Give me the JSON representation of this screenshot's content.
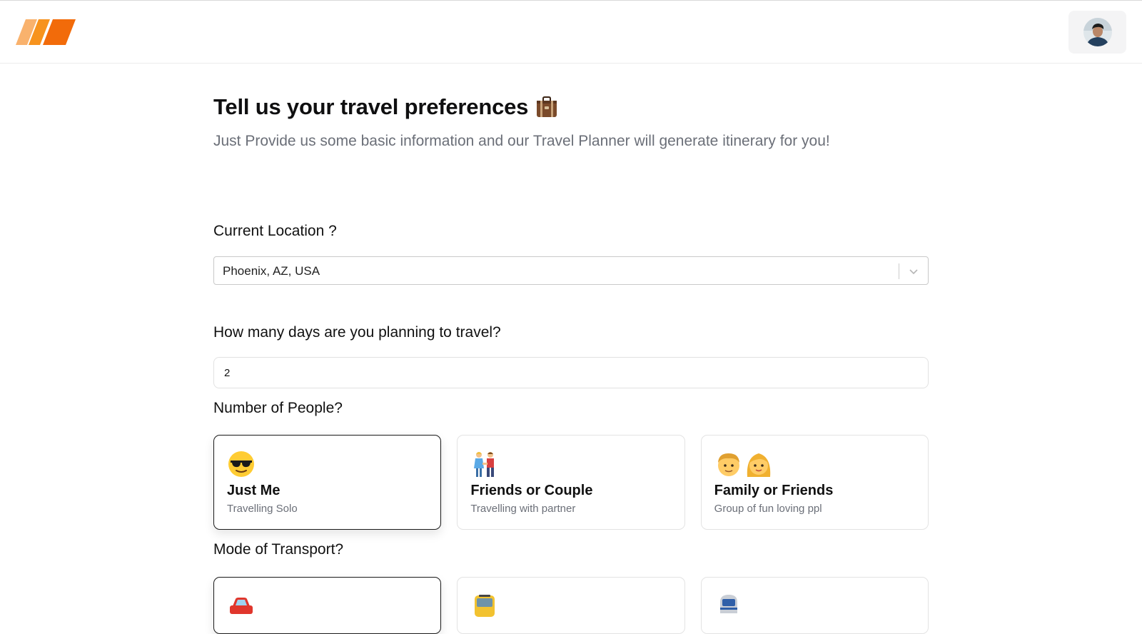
{
  "header": {
    "logo_icon": "stripes-logo-icon",
    "avatar_icon": "user-avatar-icon",
    "brand_colors": [
      "#f9b26d",
      "#f7931e",
      "#f26b0a"
    ]
  },
  "page": {
    "title": "Tell us your travel preferences",
    "title_icon": "luggage-emoji-icon",
    "subtitle": "Just Provide us some basic information and our Travel Planner will generate itinerary for you!"
  },
  "location": {
    "label": "Current Location ?",
    "value": "Phoenix, AZ, USA",
    "icon": "chevron-down-icon"
  },
  "days": {
    "label": "How many days are you planning to travel?",
    "value": "2"
  },
  "people": {
    "label": "Number of People?",
    "options": [
      {
        "icon": "sunglasses-face-icon",
        "title": "Just Me",
        "desc": "Travelling Solo",
        "selected": true
      },
      {
        "icon": "couple-holding-hands-icon",
        "title": "Friends or Couple",
        "desc": "Travelling with partner",
        "selected": false
      },
      {
        "icon": "man-woman-icon",
        "title": "Family or Friends",
        "desc": "Group of fun loving ppl",
        "selected": false
      }
    ]
  },
  "transport": {
    "label": "Mode of Transport?",
    "options": [
      {
        "icon": "car-icon",
        "selected": true
      },
      {
        "icon": "bus-icon",
        "selected": false
      },
      {
        "icon": "train-icon",
        "selected": false
      }
    ]
  }
}
